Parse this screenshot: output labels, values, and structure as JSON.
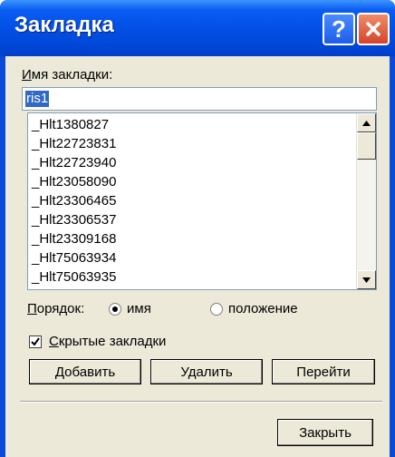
{
  "window": {
    "title": "Закладка"
  },
  "titlebar": {
    "help_glyph": "?"
  },
  "bookmark_name": {
    "label": "Имя закладки:",
    "value": "ris1"
  },
  "bookmarks": [
    "_Hlt1380827",
    "_Hlt22723831",
    "_Hlt22723940",
    "_Hlt23058090",
    "_Hlt23306465",
    "_Hlt23306537",
    "_Hlt23309168",
    "_Hlt75063934",
    "_Hlt75063935"
  ],
  "sort": {
    "label": "Порядок:",
    "option_name": "имя",
    "option_position": "положение",
    "selected": "имя"
  },
  "hidden_bookmarks": {
    "label": "Скрытые закладки",
    "checked": true
  },
  "buttons": {
    "add": "Добавить",
    "delete": "Удалить",
    "goto": "Перейти",
    "close": "Закрыть"
  },
  "colors": {
    "titlebar": "#0350e6",
    "face": "#ece9d8",
    "selection": "#316ac5"
  }
}
